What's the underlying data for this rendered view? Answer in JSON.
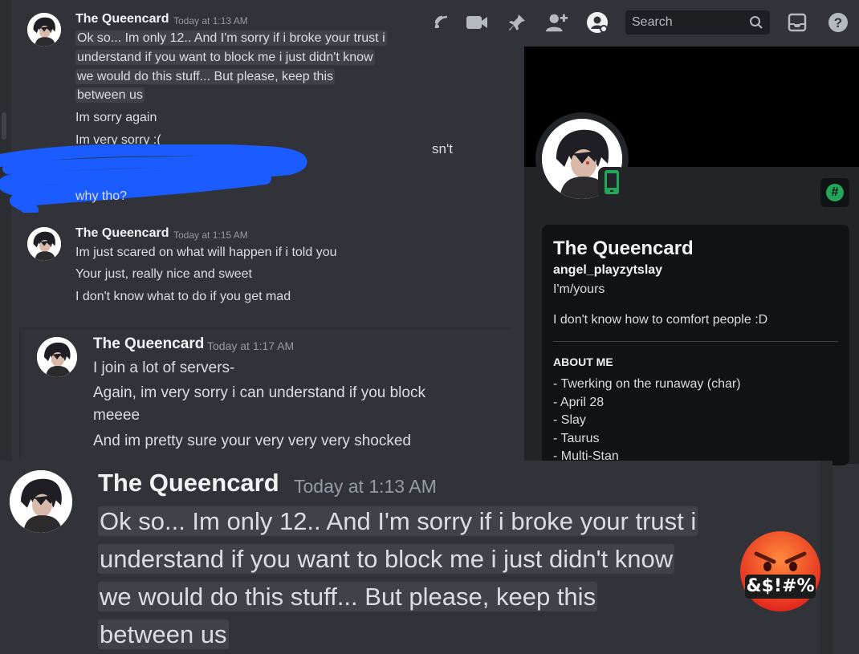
{
  "topbar": {
    "search_placeholder": "Search",
    "icons": [
      "threads-icon",
      "video-call-icon",
      "pin-icon",
      "add-friend-icon",
      "user-profile-icon",
      "search-icon",
      "inbox-icon",
      "help-icon"
    ]
  },
  "messages": [
    {
      "author": "The Queencard",
      "timestamp": "Today at 1:13 AM",
      "lines": [
        "Ok so... Im only 12.. And I'm sorry if i broke your trust i",
        "understand if you want to block me i just didn't know",
        "we would do this stuff... But please, keep this",
        "between us"
      ]
    },
    {
      "lines": [
        "Im sorry again",
        "Im very sorry :("
      ]
    },
    {
      "lines": [
        "why tho?"
      ],
      "partial_text": "sn't"
    },
    {
      "author": "The Queencard",
      "timestamp": "Today at 1:15 AM",
      "lines": [
        "Im just scared on what will happen if i told you",
        "Your just, really nice and sweet",
        "I don't know what to do if you get mad"
      ]
    },
    {
      "author": "The Queencard",
      "timestamp": "Today at 1:17 AM",
      "lines": [
        "I join a lot of servers-",
        "Again, im very sorry i can understand if you block",
        "meeee",
        "And im pretty sure your very very very shocked"
      ]
    }
  ],
  "profile": {
    "display_name": "The Queencard",
    "username": "angel_playzytslay",
    "pronouns": "I'm/yours",
    "bio": "I don't know how to comfort people :D",
    "about_heading": "ABOUT ME",
    "about_items": [
      "- Twerking on the runaway (char)",
      "- April 28",
      "- Slay",
      "- Taurus",
      "- Multi-Stan"
    ],
    "status": "mobile-online",
    "badge_icon": "hashtag-icon"
  },
  "zoom": {
    "author": "The Queencard",
    "timestamp": "Today at 1:13 AM",
    "lines": [
      "Ok so... Im only 12.. And I'm sorry if i broke your trust i",
      "understand if you want to block me i just didn't know",
      "we would do this stuff... But please, keep this",
      "between us"
    ],
    "emoji_text": "&$!#%"
  },
  "colors": {
    "accent_online": "#23a55a",
    "redaction": "#1a5cff",
    "highlight": "#404249"
  }
}
